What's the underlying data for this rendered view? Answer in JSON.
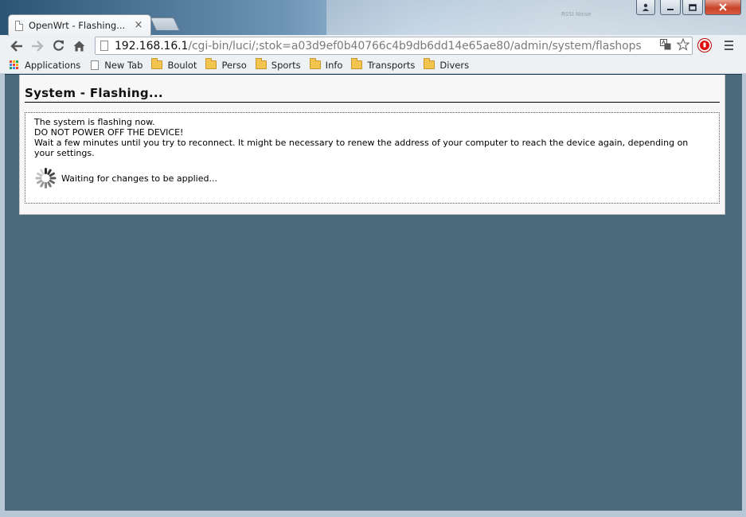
{
  "window": {
    "tab_title": "OpenWrt - Flashing...",
    "tab_close_glyph": "×",
    "desktop_peek_text": "RSSI Noise"
  },
  "toolbar": {
    "url_host": "192.168.16.1",
    "url_path": "/cgi-bin/luci/;stok=a03d9ef0b40766c4b9db6dd14e65ae80/admin/system/flashops"
  },
  "bookmarks": {
    "items": [
      {
        "label": "Applications",
        "kind": "apps"
      },
      {
        "label": "New Tab",
        "kind": "page"
      },
      {
        "label": "Boulot",
        "kind": "folder"
      },
      {
        "label": "Perso",
        "kind": "folder"
      },
      {
        "label": "Sports",
        "kind": "folder"
      },
      {
        "label": "Info",
        "kind": "folder"
      },
      {
        "label": "Transports",
        "kind": "folder"
      },
      {
        "label": "Divers",
        "kind": "folder"
      }
    ]
  },
  "page": {
    "heading": "System - Flashing...",
    "line1": "The system is flashing now.",
    "line2": "DO NOT POWER OFF THE DEVICE!",
    "line3": "Wait a few minutes until you try to reconnect. It might be necessary to renew the address of your computer to reach the device again, depending on your settings.",
    "waiting": "Waiting for changes to be applied..."
  },
  "colors": {
    "page_background": "#4a6a7c",
    "content_background": "#f7f7f7"
  }
}
